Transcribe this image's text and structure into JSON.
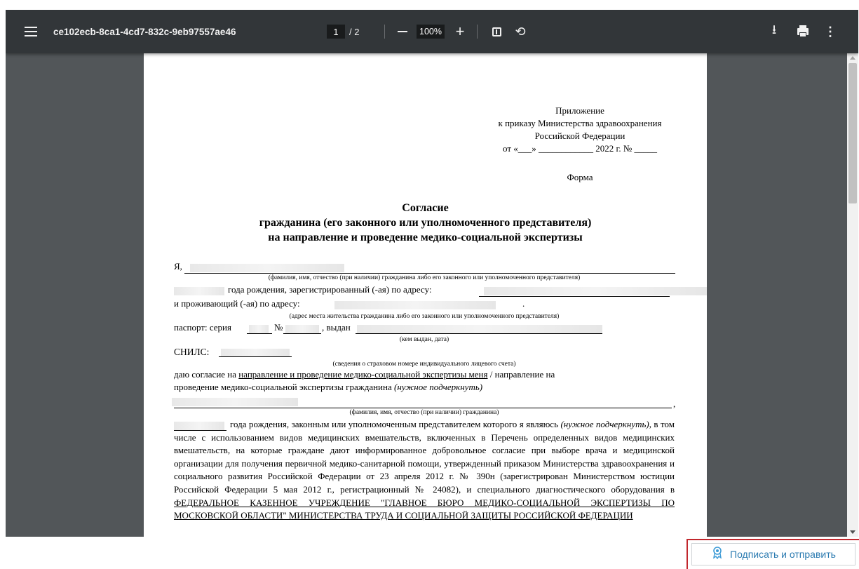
{
  "toolbar": {
    "file_name": "ce102ecb-8ca1-4cd7-832c-9eb97557ae46",
    "current_page": "1",
    "page_total": "/ 2",
    "zoom": "100%"
  },
  "document": {
    "annex": [
      "Приложение",
      "к приказу Министерства здравоохранения",
      "Российской Федерации",
      "от «___» ____________ 2022 г. № _____"
    ],
    "form_label": "Форма",
    "title_lines": [
      "Согласие",
      "гражданина (его законного или уполномоченного представителя)",
      "на направление и проведение медико-социальной экспертизы"
    ],
    "i_label": "Я,",
    "hint_fio_rep": "(фамилия, имя, отчество (при наличии) гражданина либо его законного или уполномоченного представителя)",
    "birth_reg": "года рождения, зарегистрированный (-ая) по адресу:",
    "residing": "и проживающий (-ая) по адресу:",
    "residing_end": ".",
    "hint_address": "(адрес места жительства гражданина либо его законного или уполномоченного представителя)",
    "passport_series": "паспорт: серия",
    "passport_no": "№",
    "issued": ", выдан",
    "hint_issued": "(кем выдан, дата)",
    "snils": "СНИЛС:",
    "hint_snils": "(сведения о страховом номере индивидуального лицевого счета)",
    "consent_pre": "даю согласие на ",
    "consent_self": "направление и проведение медико-социальной экспертизы меня",
    "consent_mid": " / направление на",
    "consent_line2": "проведение медико-социальной экспертизы гражданина ",
    "consent_note": "(нужное подчеркнуть)",
    "comma": ",",
    "hint_fio": "(фамилия, имя, отчество (при наличии) гражданина)",
    "para_a": "года рождения, законным или уполномоченным представителем которого я являюсь ",
    "para_note": "(нужное подчеркнуть)",
    "para_b": ", в том числе с использованием видов медицинских вмешательств, включенных в Перечень определенных видов медицинских вмешательств, на которые граждане дают информированное добровольное согласие при выборе врача и медицинской организации для получения первичной медико-санитарной помощи, утвержденный приказом Министерства здравоохранения и социального развития Российской Федерации от 23 апреля 2012 г. № 390н (зарегистрирован Министерством юстиции Российской Федерации 5 мая 2012 г., регистрационный № 24082), и специального диагностического оборудования в ",
    "org": "ФЕДЕРАЛЬНОЕ КАЗЕННОЕ УЧРЕЖДЕНИЕ \"ГЛАВНОЕ БЮРО МЕДИКО-СОЦИАЛЬНОЙ ЭКСПЕРТИЗЫ ПО МОСКОВСКОЙ ОБЛАСТИ\" МИНИСТЕРСТВА ТРУДА И СОЦИАЛЬНОЙ ЗАЩИТЫ РОССИЙСКОЙ ФЕДЕРАЦИИ"
  },
  "action": {
    "sign_label": "Подписать и отправить"
  },
  "icons": {
    "menu": "menu-icon",
    "download": "download-icon",
    "print": "print-icon",
    "more": "more-vert-icon",
    "sign": "signature-icon"
  },
  "colors": {
    "toolbar": "#323639",
    "viewer_bg": "#525659",
    "highlight": "#c1272d",
    "button_text": "#2a7ab0"
  }
}
